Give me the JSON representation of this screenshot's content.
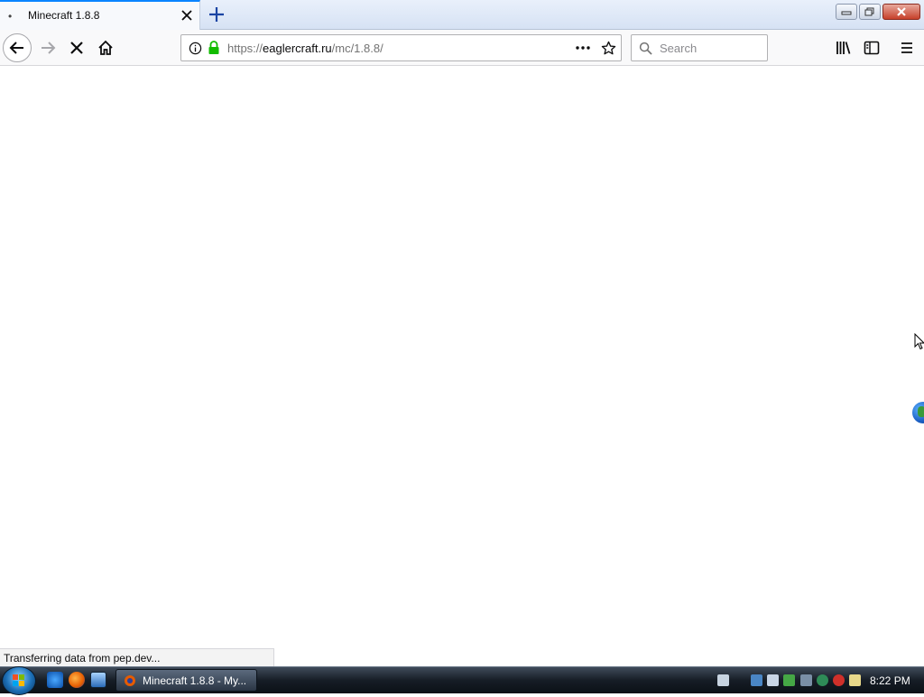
{
  "tab": {
    "title": "Minecraft 1.8.8",
    "bullet": "•"
  },
  "urlbar": {
    "scheme": "https://",
    "host": "eaglercraft.ru",
    "path": "/mc/1.8.8/"
  },
  "search": {
    "placeholder": "Search"
  },
  "status": {
    "text": "Transferring data from pep.dev..."
  },
  "taskbar": {
    "window_title": "Minecraft 1.8.8 - My...",
    "clock": "8:22 PM"
  },
  "colors": {
    "accent": "#0a84ff",
    "secure_lock": "#12bc00",
    "taskbar": "#161d26"
  },
  "icons": [
    "close-icon",
    "plus-icon",
    "back-arrow-icon",
    "forward-arrow-icon",
    "stop-loading-icon",
    "home-icon",
    "info-icon",
    "lock-icon",
    "page-actions-icon",
    "star-icon",
    "search-icon",
    "library-icon",
    "sidebar-icon",
    "hamburger-menu-icon",
    "globe-icon",
    "cursor-icon"
  ]
}
